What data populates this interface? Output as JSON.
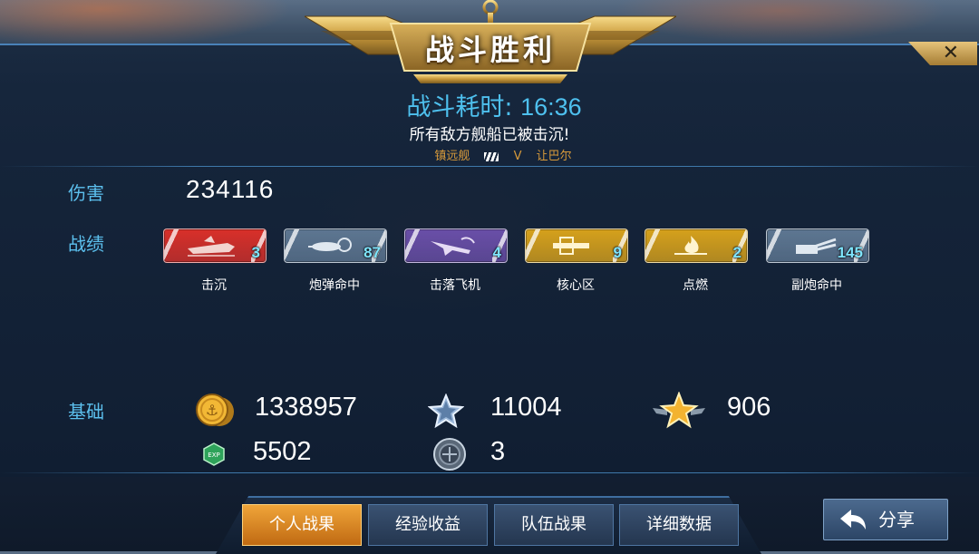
{
  "banner": {
    "title": "战斗胜利"
  },
  "close": {
    "icon": "close-icon"
  },
  "result": {
    "time_label": "战斗耗时:",
    "time_value": "16:36",
    "message": "所有敌方舰船已被击沉!",
    "own_ship": "镇远舰",
    "vs": "V",
    "enemy_ship": "让巴尔"
  },
  "damage": {
    "label": "伤害",
    "value": "234116"
  },
  "record": {
    "label": "战绩",
    "badges": [
      {
        "caption": "击沉",
        "count": "3",
        "icon": "sinking-ship-icon",
        "color": "#d9302a"
      },
      {
        "caption": "炮弹命中",
        "count": "87",
        "icon": "shell-hit-icon",
        "color": "#5e7792"
      },
      {
        "caption": "击落飞机",
        "count": "4",
        "icon": "plane-down-icon",
        "color": "#6a4fa8"
      },
      {
        "caption": "核心区",
        "count": "9",
        "icon": "core-zone-icon",
        "color": "#d6a11c"
      },
      {
        "caption": "点燃",
        "count": "2",
        "icon": "fire-icon",
        "color": "#d6a11c"
      },
      {
        "caption": "副炮命中",
        "count": "145",
        "icon": "secondary-gun-icon",
        "color": "#5e7792"
      }
    ]
  },
  "base": {
    "label": "基础",
    "gold": "1338957",
    "star": "11004",
    "rank_star": "906",
    "exp": "5502",
    "medal": "3"
  },
  "tabs": [
    {
      "label": "个人战果",
      "active": true
    },
    {
      "label": "经验收益",
      "active": false
    },
    {
      "label": "队伍战果",
      "active": false
    },
    {
      "label": "详细数据",
      "active": false
    }
  ],
  "share": {
    "label": "分享"
  }
}
